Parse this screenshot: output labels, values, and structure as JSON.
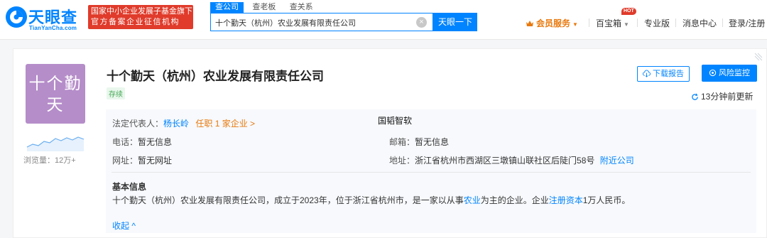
{
  "header": {
    "logo_text": "天眼查",
    "logo_sub": "TianYanCha.com",
    "gov_badge_line1": "国家中小企业发展子基金旗下",
    "gov_badge_line2": "官方备案企业征信机构",
    "search_tabs": [
      "查公司",
      "查老板",
      "查关系"
    ],
    "search_value": "十个勤天（杭州）农业发展有限责任公司",
    "search_button": "天眼一下",
    "nav": {
      "vip": "会员服务",
      "treasure": "百宝箱",
      "hot": "HOT",
      "pro": "专业版",
      "messages": "消息中心",
      "login": "登录/注册"
    }
  },
  "company": {
    "avatar_text": "十个勤天",
    "name": "十个勤天（杭州）农业发展有限责任公司",
    "status": "存续",
    "views": "浏览量：12万+",
    "download_button": "下载报告",
    "risk_button": "风险监控",
    "update_time": "13分钟前更新",
    "watermark": "国韬智软",
    "legal_rep_label": "法定代表人：",
    "legal_rep": "杨长岭",
    "legal_rep_roles": "任职 1 家企业 >",
    "phone_label": "电话：",
    "phone": "暂无信息",
    "email_label": "邮箱：",
    "email": "暂无信息",
    "website_label": "网址：",
    "website": "暂无网址",
    "address_label": "地址：",
    "address": "浙江省杭州市西湖区三墩镇山联社区后陡门58号",
    "nearby": "附近公司",
    "basic_title": "基本信息",
    "basic_desc_1": "十个勤天（杭州）农业发展有限责任公司，成立于2023年，位于浙江省杭州市，是一家以从事",
    "basic_desc_link1": "农业",
    "basic_desc_2": "为主的企业。企业",
    "basic_desc_link2": "注册资本",
    "basic_desc_3": "1万人民币。",
    "collapse": "收起 ^"
  },
  "colors": {
    "brand": "#0084ff",
    "avatar_bg": "#b58dc9",
    "gov_badge": "#e03b2b",
    "vip": "#e8790d",
    "status": "#48a95a"
  },
  "icons": [
    "logo-icon",
    "clear-icon",
    "crown-icon",
    "cloud-download-icon",
    "eye-monitor-icon",
    "refresh-icon",
    "trend-sparkline"
  ]
}
